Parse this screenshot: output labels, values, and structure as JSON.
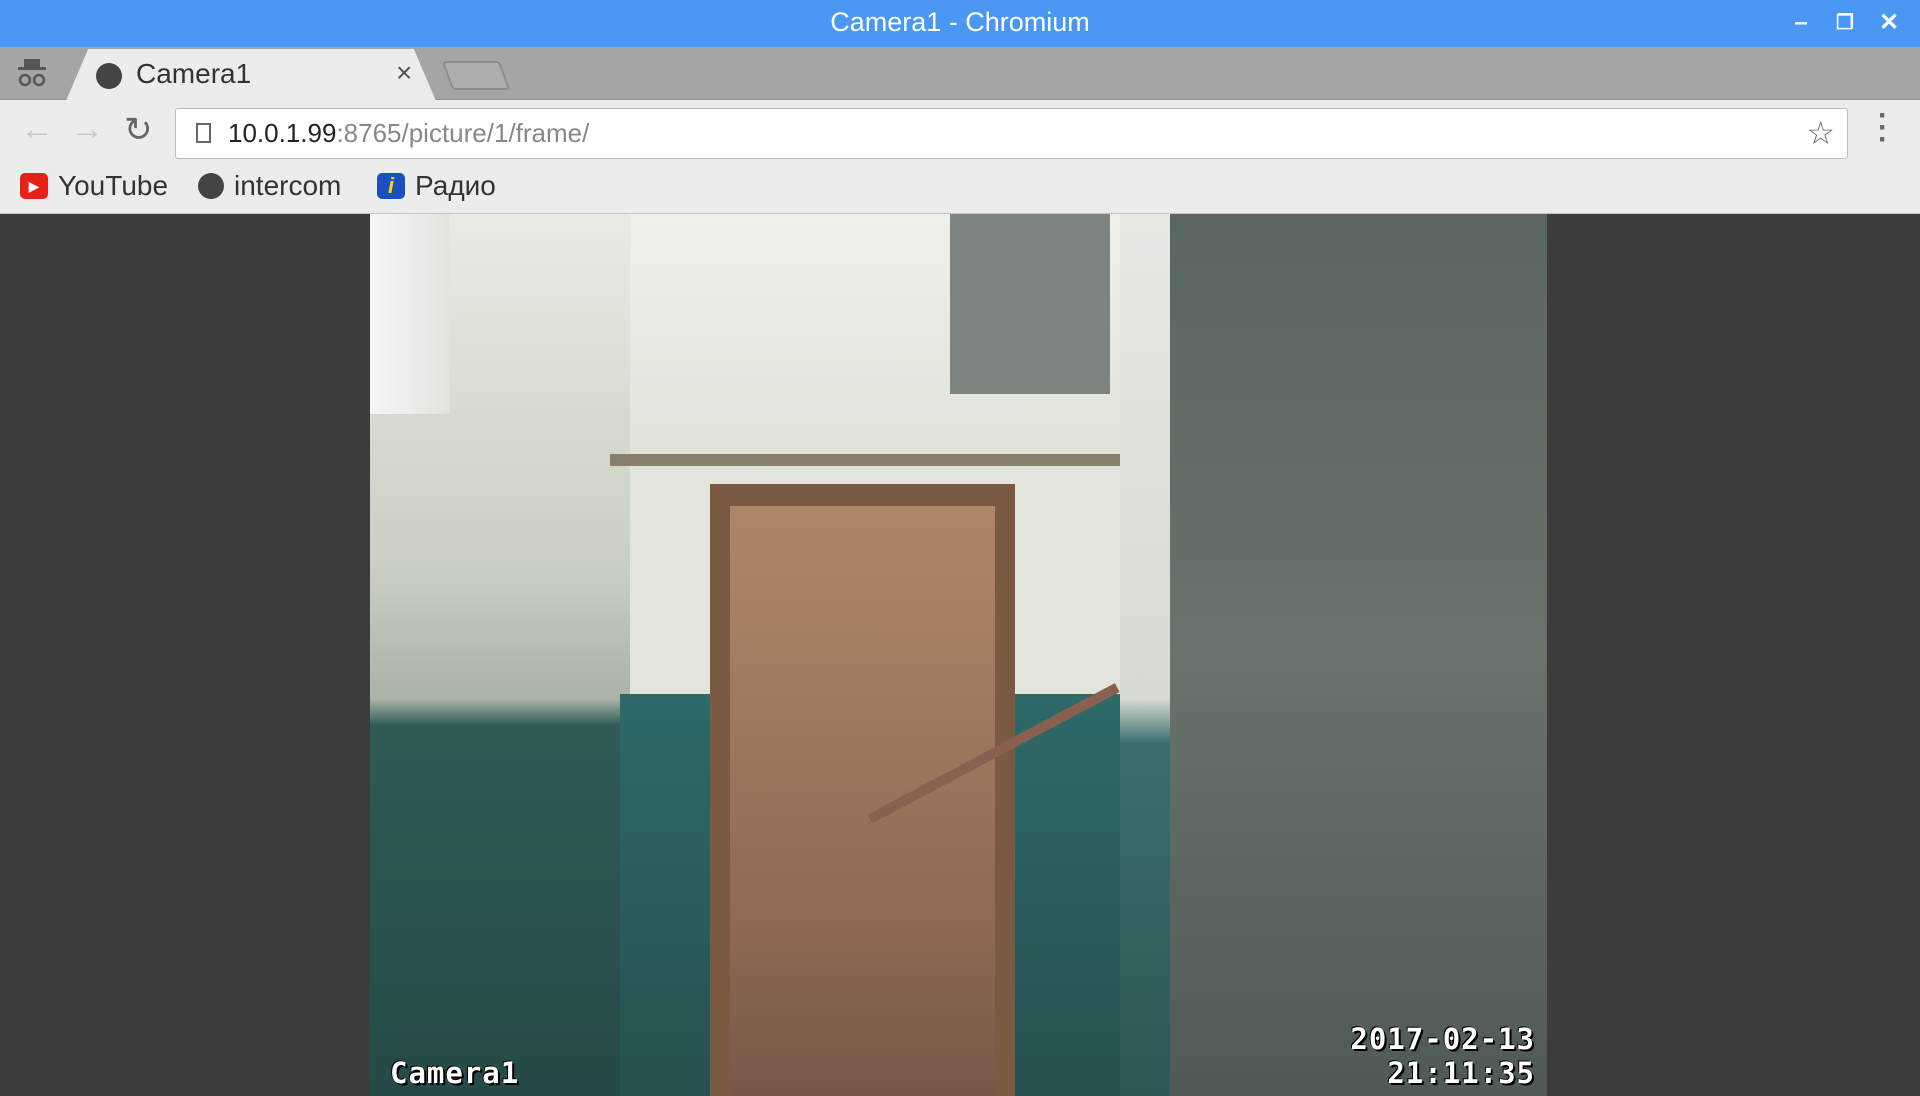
{
  "window": {
    "title": "Camera1 - Chromium",
    "controls": [
      "minimize",
      "restore",
      "close"
    ]
  },
  "tabs": [
    {
      "title": "Camera1",
      "icon": "owl-icon",
      "active": true
    }
  ],
  "omnibox": {
    "host": "10.0.1.99",
    "rest": ":8765/picture/1/frame/"
  },
  "bookmarks": [
    {
      "label": "YouTube",
      "icon": "youtube-icon",
      "color": "#e62117"
    },
    {
      "label": "intercom",
      "icon": "owl-icon",
      "color": "#444444"
    },
    {
      "label": "Радио",
      "icon": "info-icon",
      "color": "#1a4fc4"
    }
  ],
  "video": {
    "camera_label": "Camera1",
    "date": "2017-02-13",
    "time": "21:11:35"
  },
  "colors": {
    "titlebar": "#4a98f3",
    "tabstrip": "#a5a5a5",
    "toolbar": "#ececec",
    "background": "#3c3c3c"
  }
}
